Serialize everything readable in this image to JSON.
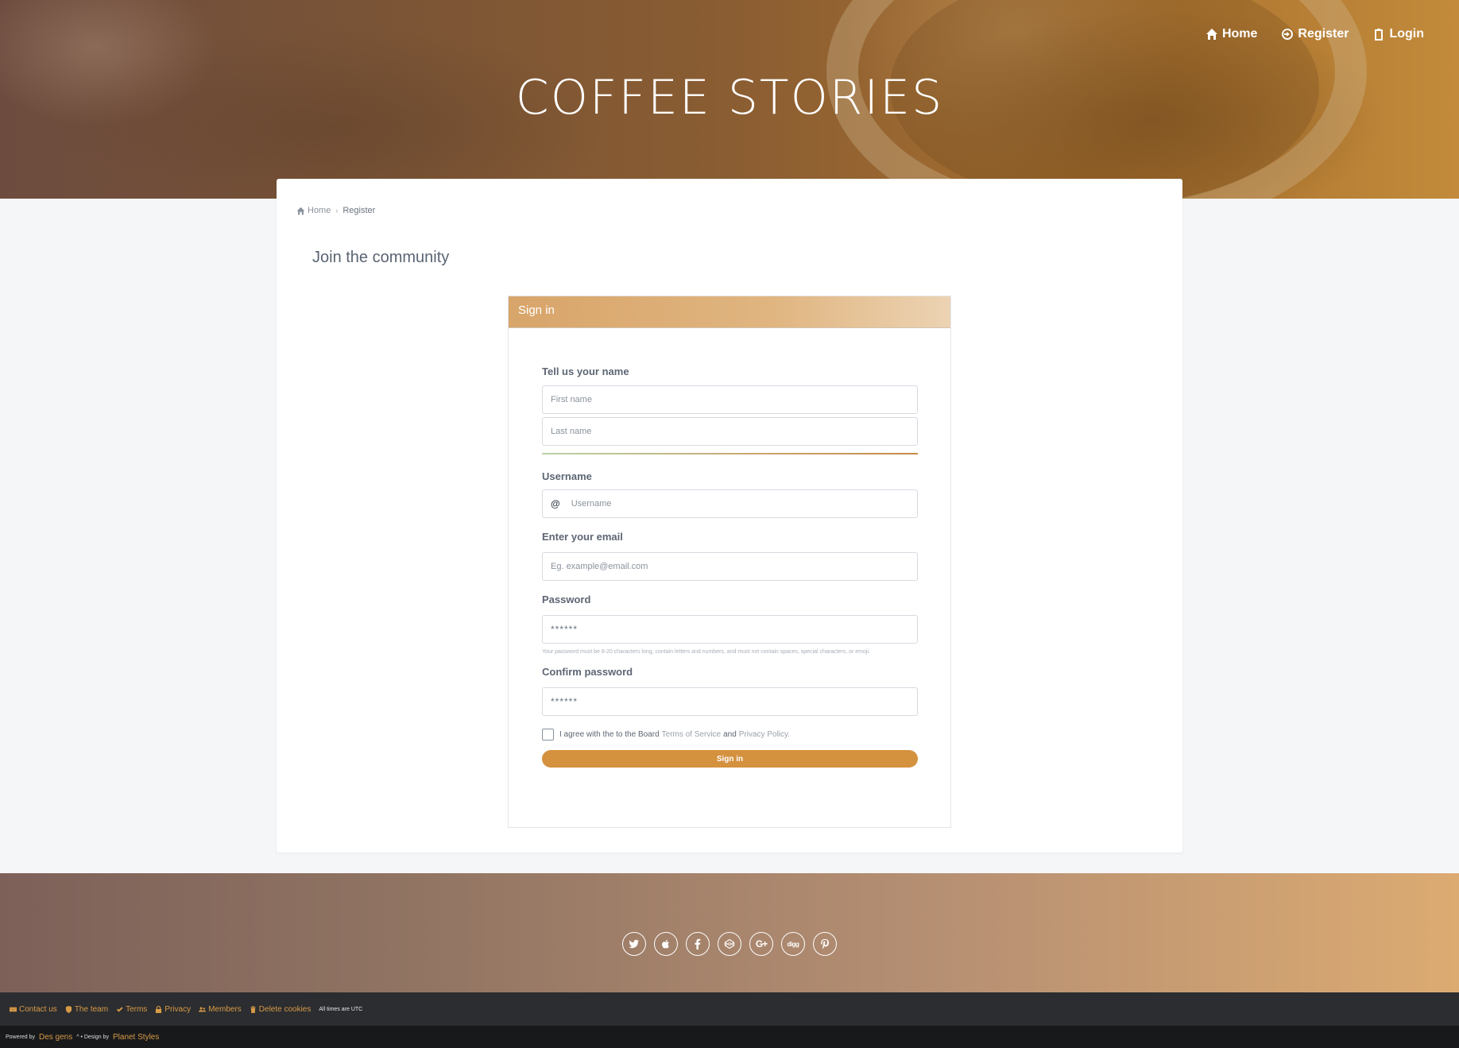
{
  "site": {
    "title": "COFFEE STORIES"
  },
  "topnav": {
    "home": "Home",
    "register": "Register",
    "login": "Login"
  },
  "breadcrumb": {
    "home": "Home",
    "current": "Register"
  },
  "page": {
    "title": "Join the community"
  },
  "card": {
    "header": "Sign in"
  },
  "form": {
    "name_label": "Tell us your name",
    "first_name_placeholder": "First name",
    "last_name_placeholder": "Last name",
    "username_label": "Username",
    "username_prefix": "@",
    "username_placeholder": "Username",
    "email_label": "Enter your email",
    "email_placeholder": "Eg. example@email.com",
    "password_label": "Password",
    "password_value": "******",
    "password_hint": "Your password must be 8-20 characters long, contain letters and numbers, and must not contain spaces, special characters, or emoji.",
    "confirm_label": "Confirm password",
    "confirm_value": "******",
    "agree_prefix": "I agree with the to the Board",
    "agree_terms": "Terms of Service",
    "agree_and": "and",
    "agree_privacy": "Privacy Policy.",
    "submit": "Sign in"
  },
  "socials": [
    "twitter-icon",
    "apple-icon",
    "facebook-icon",
    "codepen-icon",
    "google-plus-icon",
    "digg-icon",
    "pinterest-icon"
  ],
  "footer": {
    "contact": "Contact us",
    "team": "The team",
    "terms": "Terms",
    "privacy": "Privacy",
    "members": "Members",
    "delete_cookies": "Delete cookies",
    "timezone": "All times are UTC",
    "powered_by": "Powered by",
    "powered_name": "Des gens",
    "design_by": "^ • Design by",
    "design_name": "Planet Styles"
  },
  "colors": {
    "accent": "#d4913e",
    "link": "#d89a47",
    "footer_dark": "#2b2d30"
  }
}
